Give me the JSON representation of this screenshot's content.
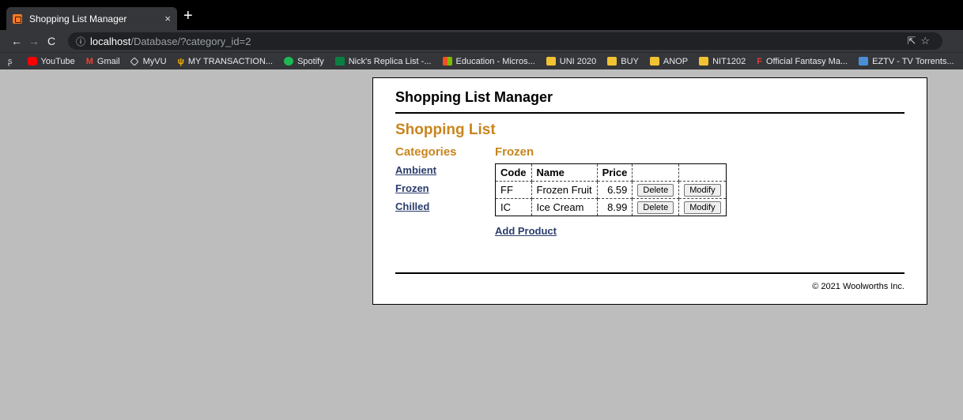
{
  "browser": {
    "tab_title": "Shopping List Manager",
    "tab_close": "×",
    "new_tab": "+",
    "url_host": "localhost",
    "url_path": "/Database/?category_id=2",
    "bookmarks": [
      {
        "label": "YouTube",
        "icon": "youtube-icon"
      },
      {
        "label": "Gmail",
        "icon": "gmail-icon"
      },
      {
        "label": "MyVU",
        "icon": "myvu-icon"
      },
      {
        "label": "MY TRANSACTION...",
        "icon": "transaction-icon"
      },
      {
        "label": "Spotify",
        "icon": "spotify-icon"
      },
      {
        "label": "Nick's Replica List -...",
        "icon": "sheets-icon"
      },
      {
        "label": "Education - Micros...",
        "icon": "microsoft-icon"
      },
      {
        "label": "UNI 2020",
        "icon": "folder-icon"
      },
      {
        "label": "BUY",
        "icon": "folder-icon"
      },
      {
        "label": "ANOP",
        "icon": "folder-icon"
      },
      {
        "label": "NIT1202",
        "icon": "folder-icon"
      },
      {
        "label": "Official Fantasy Ma...",
        "icon": "fantasy-icon"
      },
      {
        "label": "EZTV - TV Torrents...",
        "icon": "eztv-icon"
      }
    ]
  },
  "page": {
    "header": "Shopping List Manager",
    "heading": "Shopping List",
    "categories_heading": "Categories",
    "categories": [
      "Ambient",
      "Frozen",
      "Chilled"
    ],
    "current_category": "Frozen",
    "table": {
      "columns": [
        "Code",
        "Name",
        "Price"
      ],
      "rows": [
        {
          "code": "FF",
          "name": "Frozen Fruit",
          "price": "6.59"
        },
        {
          "code": "IC",
          "name": "Ice Cream",
          "price": "8.99"
        }
      ],
      "delete_label": "Delete",
      "modify_label": "Modify"
    },
    "add_product": "Add Product",
    "footer": "© 2021 Woolworths Inc."
  }
}
